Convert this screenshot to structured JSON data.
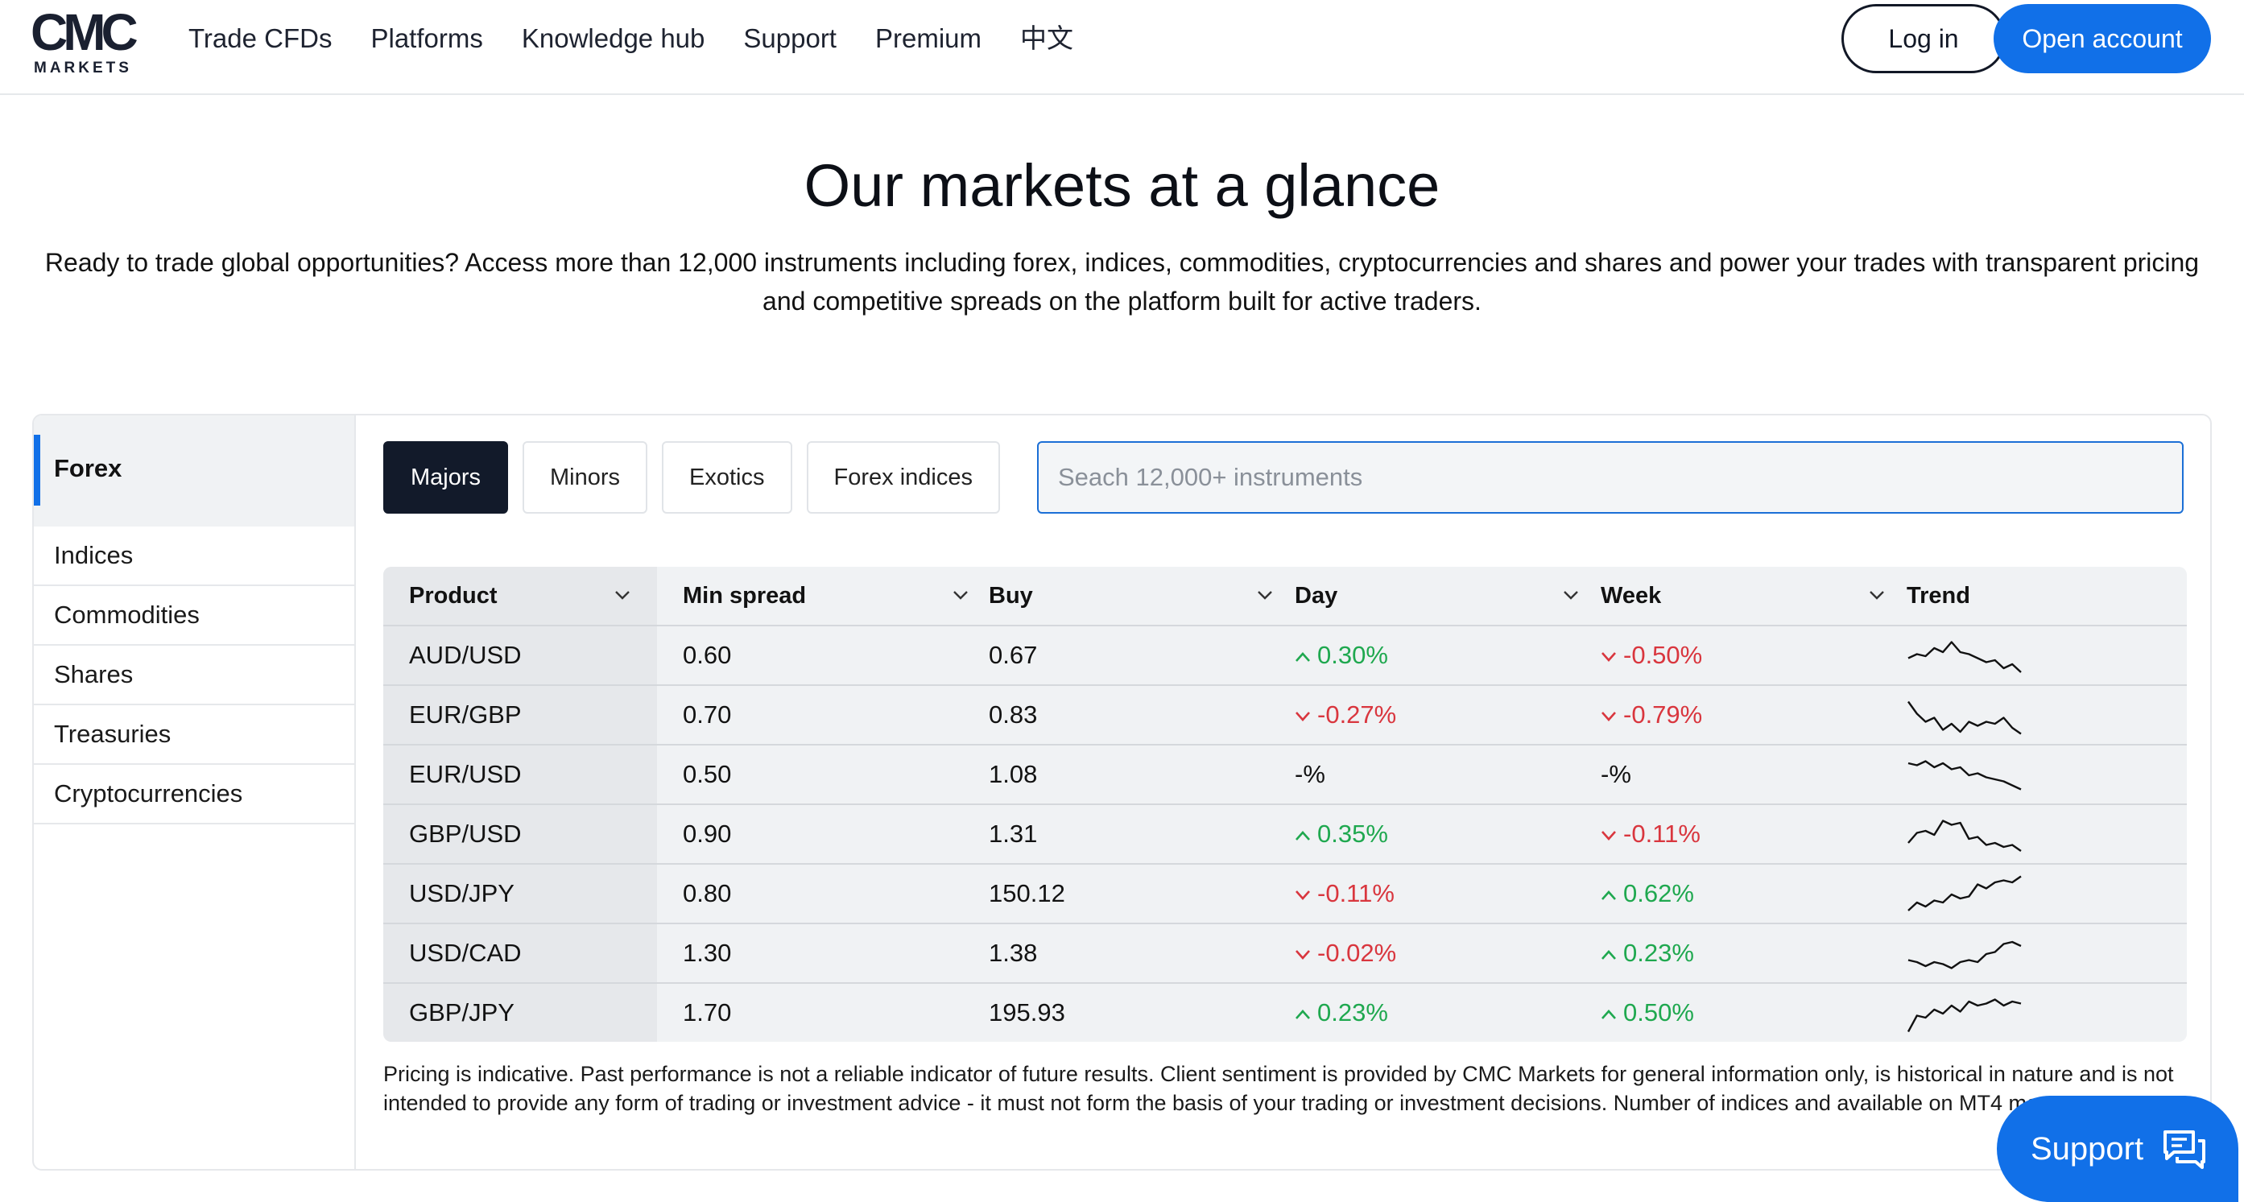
{
  "header": {
    "logo_mark": "CMC",
    "logo_sub": "MARKETS",
    "nav": [
      {
        "label": "Trade CFDs"
      },
      {
        "label": "Platforms"
      },
      {
        "label": "Knowledge hub"
      },
      {
        "label": "Support"
      },
      {
        "label": "Premium"
      },
      {
        "label": "中文"
      }
    ],
    "login_label": "Log in",
    "open_account_label": "Open account"
  },
  "hero": {
    "title": "Our markets at a glance",
    "description": "Ready to trade global opportunities? Access more than 12,000 instruments including forex, indices, commodities, cryptocurrencies and shares and power your trades with transparent pricing and competitive spreads on the platform built for active traders."
  },
  "sidebar": {
    "items": [
      {
        "label": "Forex",
        "active": true
      },
      {
        "label": "Indices"
      },
      {
        "label": "Commodities"
      },
      {
        "label": "Shares"
      },
      {
        "label": "Treasuries"
      },
      {
        "label": "Cryptocurrencies"
      }
    ]
  },
  "tabs": [
    {
      "label": "Majors",
      "active": true
    },
    {
      "label": "Minors"
    },
    {
      "label": "Exotics"
    },
    {
      "label": "Forex indices"
    }
  ],
  "search": {
    "placeholder": "Seach 12,000+ instruments",
    "value": ""
  },
  "table": {
    "headers": [
      "Product",
      "Min spread",
      "Buy",
      "Day",
      "Week",
      "Trend"
    ],
    "rows": [
      {
        "product": "AUD/USD",
        "min_spread": "0.60",
        "buy": "0.67",
        "day": "0.30%",
        "day_dir": "up",
        "week": "-0.50%",
        "week_dir": "down",
        "trend": [
          0.45,
          0.55,
          0.5,
          0.7,
          0.6,
          0.85,
          0.6,
          0.55,
          0.45,
          0.35,
          0.4,
          0.2,
          0.3,
          0.1
        ]
      },
      {
        "product": "EUR/GBP",
        "min_spread": "0.70",
        "buy": "0.83",
        "day": "-0.27%",
        "day_dir": "down",
        "week": "-0.79%",
        "week_dir": "down",
        "trend": [
          0.85,
          0.55,
          0.35,
          0.45,
          0.15,
          0.3,
          0.1,
          0.35,
          0.25,
          0.35,
          0.3,
          0.45,
          0.2,
          0.05
        ]
      },
      {
        "product": "EUR/USD",
        "min_spread": "0.50",
        "buy": "1.08",
        "day": "-%",
        "day_dir": "none",
        "week": "-%",
        "week_dir": "none",
        "trend": [
          0.8,
          0.75,
          0.85,
          0.7,
          0.8,
          0.65,
          0.7,
          0.5,
          0.55,
          0.45,
          0.4,
          0.35,
          0.25,
          0.15
        ]
      },
      {
        "product": "GBP/USD",
        "min_spread": "0.90",
        "buy": "1.31",
        "day": "0.35%",
        "day_dir": "up",
        "week": "-0.11%",
        "week_dir": "down",
        "trend": [
          0.3,
          0.55,
          0.6,
          0.5,
          0.85,
          0.75,
          0.8,
          0.4,
          0.45,
          0.25,
          0.3,
          0.2,
          0.25,
          0.1
        ]
      },
      {
        "product": "USD/JPY",
        "min_spread": "0.80",
        "buy": "150.12",
        "day": "-0.11%",
        "day_dir": "down",
        "week": "0.62%",
        "week_dir": "up",
        "trend": [
          0.1,
          0.3,
          0.2,
          0.35,
          0.3,
          0.5,
          0.4,
          0.45,
          0.75,
          0.65,
          0.8,
          0.85,
          0.8,
          0.95
        ]
      },
      {
        "product": "USD/CAD",
        "min_spread": "1.30",
        "buy": "1.38",
        "day": "-0.02%",
        "day_dir": "down",
        "week": "0.23%",
        "week_dir": "up",
        "trend": [
          0.35,
          0.3,
          0.2,
          0.3,
          0.25,
          0.15,
          0.3,
          0.35,
          0.3,
          0.5,
          0.55,
          0.75,
          0.8,
          0.7
        ]
      },
      {
        "product": "GBP/JPY",
        "min_spread": "1.70",
        "buy": "195.93",
        "day": "0.23%",
        "day_dir": "up",
        "week": "0.50%",
        "week_dir": "up",
        "trend": [
          0.05,
          0.45,
          0.4,
          0.6,
          0.5,
          0.7,
          0.55,
          0.8,
          0.7,
          0.75,
          0.85,
          0.7,
          0.8,
          0.75
        ]
      }
    ]
  },
  "disclaimer": "Pricing is indicative. Past performance is not a reliable indicator of future results. Client sentiment is provided by CMC Markets for general information only, is historical in nature and is not intended to provide any form of trading or investment advice - it must not form the basis of your trading or investment decisions. Number of indices and available on MT4 may vary.",
  "support_widget": {
    "label": "Support"
  },
  "colors": {
    "brand_blue": "#1170e8",
    "positive": "#1fa84f",
    "negative": "#d9363e",
    "dark_tab": "#121a2a"
  }
}
